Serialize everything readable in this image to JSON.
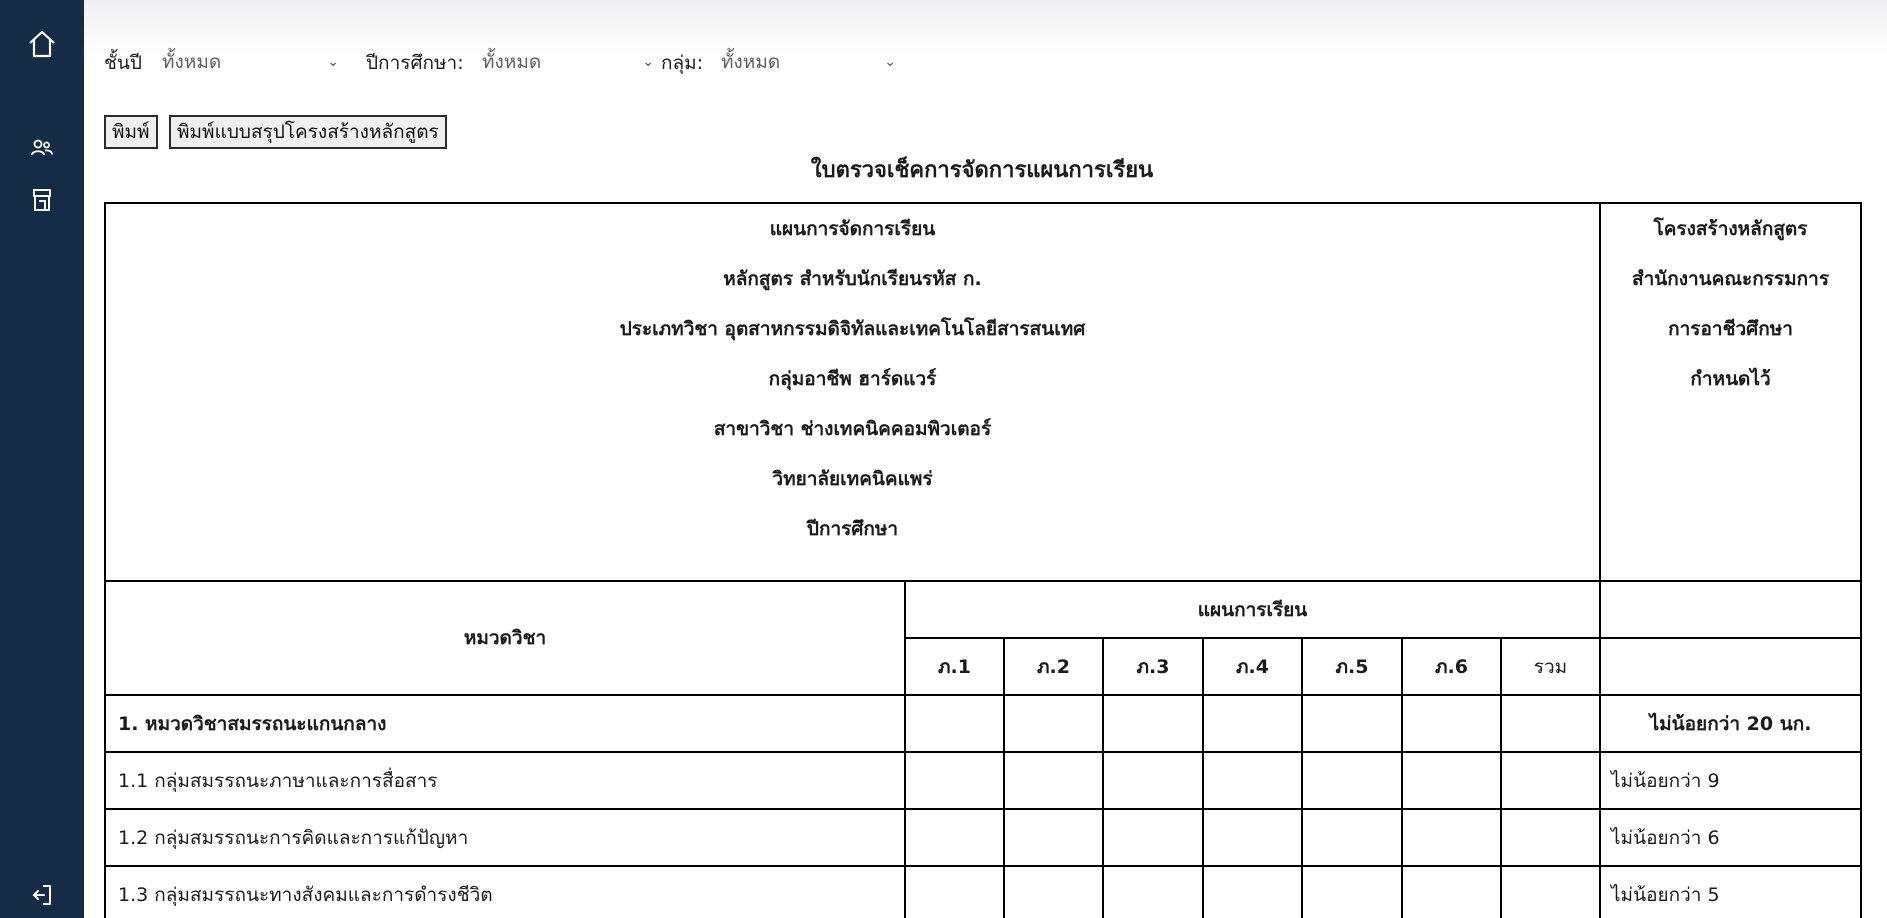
{
  "sidebar": {
    "icons": [
      "home-icon",
      "users-icon",
      "store-icon",
      "logout-icon"
    ]
  },
  "filters": {
    "grade_label": "ชั้นปี",
    "grade_value": "ทั้งหมด",
    "year_label": "ปีการศึกษา:",
    "year_value": "ทั้งหมด",
    "group_label": "กลุ่ม:",
    "group_value": "ทั้งหมด"
  },
  "buttons": {
    "print": "พิมพ์",
    "print_summary": "พิมพ์แบบสรุปโครงสร้างหลักสูตร"
  },
  "document": {
    "title": "ใบตรวจเช็คการจัดการแผนการเรียน",
    "header_lines": [
      "แผนการจัดการเรียน",
      "หลักสูตร สำหรับนักเรียนรหัส ก.",
      "ประเภทวิชา อุตสาหกรรมดิจิทัลและเทคโนโลยีสารสนเทศ",
      "กลุ่มอาชีพ ฮาร์ดแวร์",
      "สาขาวิชา ช่างเทคนิคคอมพิวเตอร์",
      "วิทยาลัยเทคนิคแพร่",
      "ปีการศึกษา"
    ],
    "side_lines": [
      "โครงสร้างหลักสูตร",
      "สำนักงานคณะกรรมการ",
      "การอาชีวศึกษา",
      "กำหนดไว้"
    ],
    "category_header": "หมวดวิชา",
    "plan_header": "แผนการเรียน",
    "terms": [
      "ภ.1",
      "ภ.2",
      "ภ.3",
      "ภ.4",
      "ภ.5",
      "ภ.6"
    ],
    "total_header": "รวม",
    "rows": [
      {
        "category": "1. หมวดวิชาสมรรถนะแกนกลาง",
        "standard": "ไม่น้อยกว่า 20 นก."
      },
      {
        "category": "1.1 กลุ่มสมรรถนะภาษาและการสื่อสาร",
        "standard": "ไม่น้อยกว่า 9"
      },
      {
        "category": "1.2 กลุ่มสมรรถนะการคิดและการแก้ปัญหา",
        "standard": "ไม่น้อยกว่า 6"
      },
      {
        "category": "1.3 กลุ่มสมรรถนะทางสังคมและการดำรงชีวิต",
        "standard": "ไม่น้อยกว่า 5"
      }
    ]
  }
}
